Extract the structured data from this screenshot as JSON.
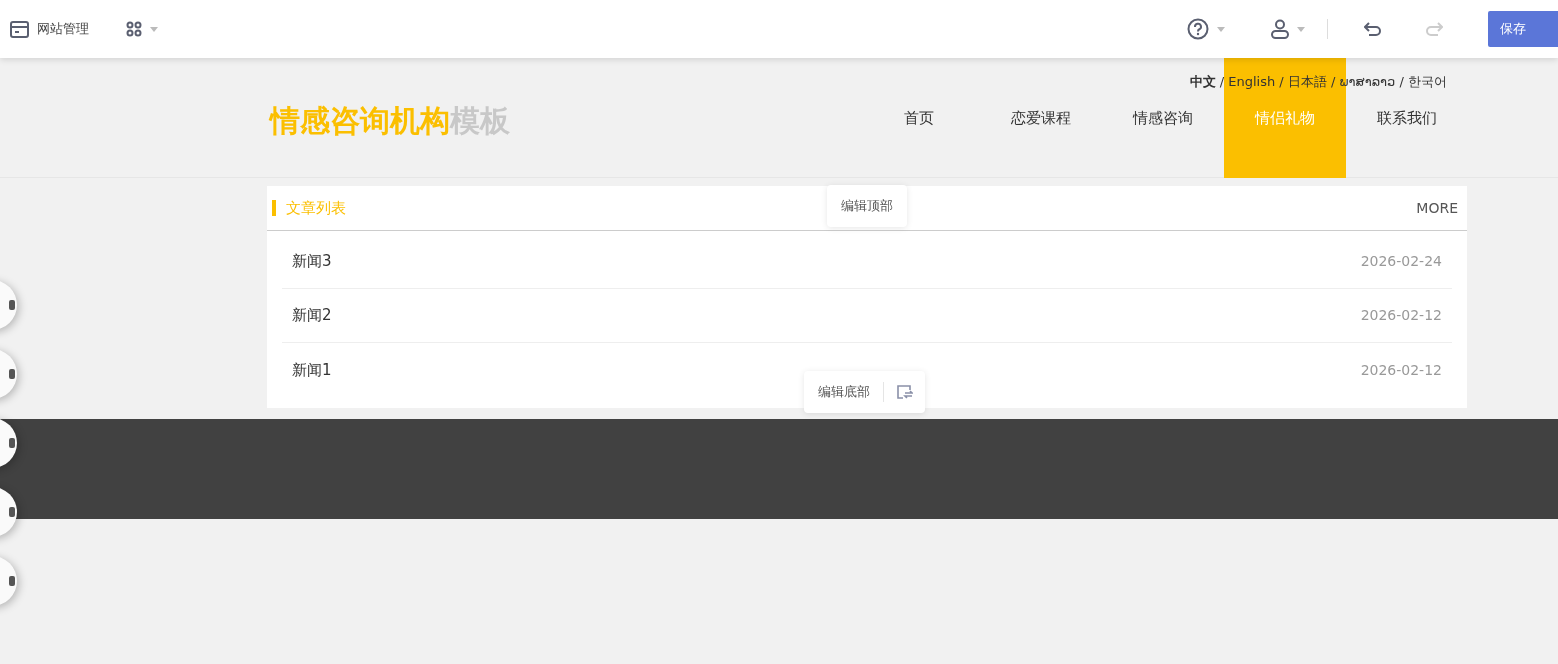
{
  "toolbar": {
    "site_manage": "网站管理",
    "save": "保存"
  },
  "languages": [
    {
      "label": "中文",
      "selected": true
    },
    {
      "label": "English",
      "selected": false
    },
    {
      "label": "日本語",
      "selected": false
    },
    {
      "label": "ພາສາລາວ",
      "selected": false
    },
    {
      "label": "한국어",
      "selected": false
    }
  ],
  "language_separator": "/",
  "logo": {
    "primary": "情感咨询机构",
    "secondary": "模板"
  },
  "nav": [
    {
      "label": "首页",
      "selected": false
    },
    {
      "label": "恋爱课程",
      "selected": false
    },
    {
      "label": "情感咨询",
      "selected": false
    },
    {
      "label": "情侣礼物",
      "selected": true
    },
    {
      "label": "联系我们",
      "selected": false
    }
  ],
  "article_list": {
    "title": "文章列表",
    "more": "MORE",
    "rows": [
      {
        "title": "新闻3",
        "date": "2026-02-24"
      },
      {
        "title": "新闻2",
        "date": "2026-02-12"
      },
      {
        "title": "新闻1",
        "date": "2026-02-12"
      }
    ]
  },
  "edit_top": "编辑顶部",
  "edit_bottom": "编辑底部"
}
